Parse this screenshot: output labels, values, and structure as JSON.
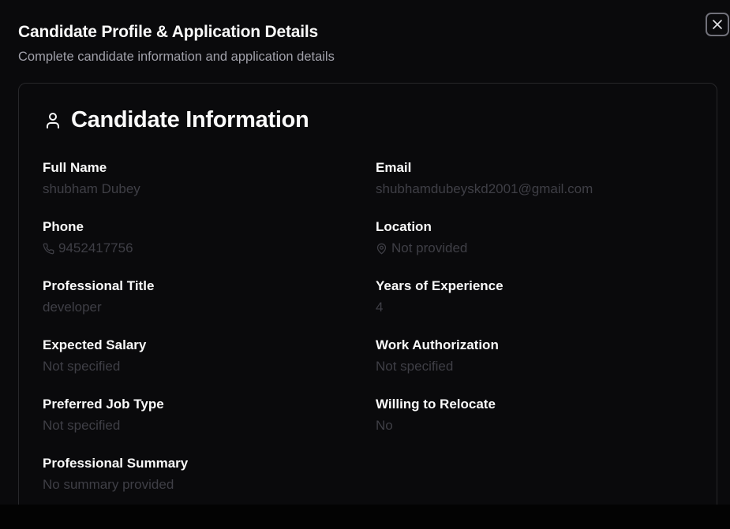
{
  "dialog": {
    "title": "Candidate Profile & Application Details",
    "subtitle": "Complete candidate information and application details",
    "close_icon": "close-icon"
  },
  "card": {
    "title": "Candidate Information",
    "icon": "user-icon"
  },
  "fields": {
    "full_name": {
      "label": "Full Name",
      "value": "shubham Dubey"
    },
    "email": {
      "label": "Email",
      "value": "shubhamdubeyskd2001@gmail.com"
    },
    "phone": {
      "label": "Phone",
      "value": "9452417756",
      "icon": "phone-icon"
    },
    "location": {
      "label": "Location",
      "value": "Not provided",
      "icon": "map-pin-icon"
    },
    "professional_title": {
      "label": "Professional Title",
      "value": "developer"
    },
    "years_experience": {
      "label": "Years of Experience",
      "value": "4"
    },
    "expected_salary": {
      "label": "Expected Salary",
      "value": "Not specified"
    },
    "work_authorization": {
      "label": "Work Authorization",
      "value": "Not specified"
    },
    "preferred_job_type": {
      "label": "Preferred Job Type",
      "value": "Not specified"
    },
    "willing_to_relocate": {
      "label": "Willing to Relocate",
      "value": "No"
    },
    "professional_summary": {
      "label": "Professional Summary",
      "value": "No summary provided"
    }
  },
  "colors": {
    "background": "#0a0a0c",
    "label": "#fafafa",
    "value": "#3f3f46",
    "border": "#27272a"
  }
}
